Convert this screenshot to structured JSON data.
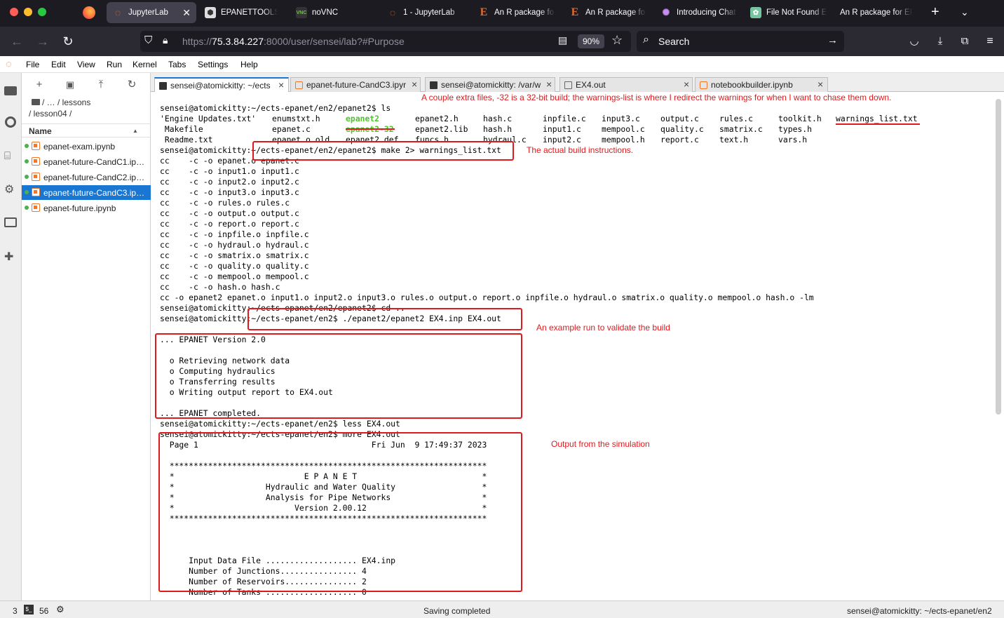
{
  "browser_tabs": [
    {
      "label": "JupyterLab",
      "active": true
    },
    {
      "label": "EPANETTOOLS -"
    },
    {
      "label": "noVNC"
    },
    {
      "label": "1 - JupyterLab"
    },
    {
      "label": "An R package fo"
    },
    {
      "label": "An R package fo"
    },
    {
      "label": "Introducing Chat"
    },
    {
      "label": "File Not Found E"
    },
    {
      "label": "An R package for EP"
    }
  ],
  "navbar": {
    "url_prefix": "https://",
    "url_host": "75.3.84.227",
    "url_rest": ":8000/user/sensei/lab?#Purpose",
    "zoom": "90%",
    "search_placeholder": "Search"
  },
  "menu": [
    "File",
    "Edit",
    "View",
    "Run",
    "Kernel",
    "Tabs",
    "Settings",
    "Help"
  ],
  "filebrowser": {
    "breadcrumb_line1": "/   …   / lessons",
    "breadcrumb_line2": "/ lesson04 /",
    "column_name": "Name",
    "items": [
      {
        "name": "epanet-exam.ipynb"
      },
      {
        "name": "epanet-future-CandC1.ipynb"
      },
      {
        "name": "epanet-future-CandC2.ipynb"
      },
      {
        "name": "epanet-future-CandC3.ipynb",
        "selected": true
      },
      {
        "name": "epanet-future.ipynb"
      }
    ]
  },
  "doc_tabs": [
    {
      "label": "sensei@atomickitty: ~/ects",
      "type": "term",
      "active": true
    },
    {
      "label": "epanet-future-CandC3.ipyr",
      "type": "nb"
    },
    {
      "label": "sensei@atomickitty: /var/w",
      "type": "term"
    },
    {
      "label": "EX4.out",
      "type": "file"
    },
    {
      "label": "notebookbuilder.ipynb",
      "type": "nb"
    }
  ],
  "terminal": {
    "lines": [
      "sensei@atomickitty:~/ects-epanet/en2/epanet2$ ls",
      "",
      "",
      "",
      "sensei@atomickitty:~/ects-epanet/en2/epanet2$ make 2> warnings_list.txt",
      "cc    -c -o epanet.o epanet.c",
      "cc    -c -o input1.o input1.c",
      "cc    -c -o input2.o input2.c",
      "cc    -c -o input3.o input3.c",
      "cc    -c -o rules.o rules.c",
      "cc    -c -o output.o output.c",
      "cc    -c -o report.o report.c",
      "cc    -c -o inpfile.o inpfile.c",
      "cc    -c -o hydraul.o hydraul.c",
      "cc    -c -o smatrix.o smatrix.c",
      "cc    -c -o quality.o quality.c",
      "cc    -c -o mempool.o mempool.c",
      "cc    -c -o hash.o hash.c",
      "cc -o epanet2 epanet.o input1.o input2.o input3.o rules.o output.o report.o inpfile.o hydraul.o smatrix.o quality.o mempool.o hash.o -lm",
      "sensei@atomickitty:~/ects-epanet/en2/epanet2$ cd ..",
      "sensei@atomickitty:~/ects-epanet/en2$ ./epanet2/epanet2 EX4.inp EX4.out",
      "",
      "... EPANET Version 2.0",
      "",
      "  o Retrieving network data",
      "  o Computing hydraulics",
      "  o Transferring results",
      "  o Writing output report to EX4.out",
      "",
      "... EPANET completed.",
      "sensei@atomickitty:~/ects-epanet/en2$ less EX4.out",
      "sensei@atomickitty:~/ects-epanet/en2$ more EX4.out",
      "  Page 1                                    Fri Jun  9 17:49:37 2023",
      "",
      "  ******************************************************************",
      "  *                           E P A N E T                          *",
      "  *                   Hydraulic and Water Quality                  *",
      "  *                   Analysis for Pipe Networks                   *",
      "  *                         Version 2.00.12                        *",
      "  ******************************************************************",
      "",
      "",
      "",
      "      Input Data File ................... EX4.inp",
      "      Number of Junctions................ 4",
      "      Number of Reservoirs............... 2",
      "      Number of Tanks ................... 0"
    ],
    "ls_columns": [
      [
        "'Engine Updates.txt'",
        " Makefile",
        " Readme.txt"
      ],
      [
        "enumstxt.h",
        "epanet.c",
        "epanet.o.old"
      ],
      [
        "epanet2",
        "epanet2-32",
        "epanet2.def"
      ],
      [
        "epanet2.h",
        "epanet2.lib",
        "funcs.h"
      ],
      [
        "hash.c",
        "hash.h",
        "hydraul.c"
      ],
      [
        "inpfile.c",
        "input1.c",
        "input2.c"
      ],
      [
        "input3.c",
        "mempool.c",
        "mempool.h"
      ],
      [
        "output.c",
        "quality.c",
        "report.c"
      ],
      [
        "rules.c",
        "smatrix.c",
        "text.h"
      ],
      [
        "toolkit.h",
        "types.h",
        "vars.h"
      ],
      [
        "warnings_list.txt",
        "",
        ""
      ]
    ]
  },
  "annotations": {
    "extra_files": "A couple extra files, -32 is a 32-bit build; the warnings-list is where I redirect the warnings for when I want to chase them down.",
    "build": "The actual build instructions.",
    "example_run": "An example run to validate the build",
    "output": "Output from the simulation"
  },
  "status": {
    "count1": "3",
    "count2": "56",
    "center": "Saving completed",
    "right": "sensei@atomickitty: ~/ects-epanet/en2"
  },
  "colors": {
    "annotation_red": "#e0191d",
    "executable_green": "#4fc32a",
    "jupyter_blue": "#1976d2"
  }
}
